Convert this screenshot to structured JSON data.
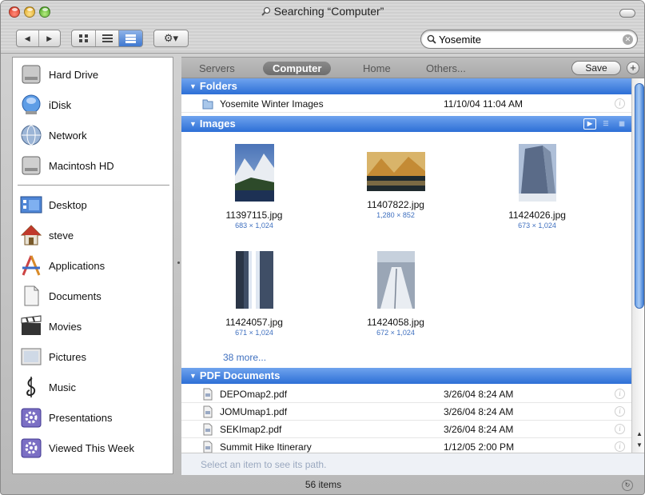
{
  "window": {
    "title": "Searching “Computer”",
    "status": "56 items"
  },
  "toolbar": {
    "back_glyph": "◀",
    "forward_glyph": "▶",
    "action_glyph": "⚙▾",
    "search_value": "Yosemite",
    "search_clear_glyph": "✕"
  },
  "sidebar": {
    "devices": [
      {
        "label": "Hard Drive",
        "icon": "hard-drive-icon"
      },
      {
        "label": "iDisk",
        "icon": "idisk-icon"
      },
      {
        "label": "Network",
        "icon": "network-icon"
      },
      {
        "label": "Macintosh HD",
        "icon": "macintosh-hd-icon"
      }
    ],
    "places": [
      {
        "label": "Desktop",
        "icon": "desktop-icon"
      },
      {
        "label": "steve",
        "icon": "home-icon"
      },
      {
        "label": "Applications",
        "icon": "applications-icon"
      },
      {
        "label": "Documents",
        "icon": "documents-icon"
      },
      {
        "label": "Movies",
        "icon": "movies-icon"
      },
      {
        "label": "Pictures",
        "icon": "pictures-icon"
      },
      {
        "label": "Music",
        "icon": "music-icon"
      },
      {
        "label": "Presentations",
        "icon": "smart-folder-icon"
      },
      {
        "label": "Viewed This Week",
        "icon": "smart-folder-icon"
      }
    ]
  },
  "scope": {
    "items": [
      "Servers",
      "Computer",
      "Home",
      "Others..."
    ],
    "active": "Computer",
    "save_label": "Save",
    "add_glyph": "+"
  },
  "sections": {
    "folders": {
      "title": "Folders",
      "rows": [
        {
          "name": "Yosemite Winter Images",
          "date": "11/10/04 11:04 AM"
        }
      ]
    },
    "images": {
      "title": "Images",
      "items": [
        {
          "name": "11397115.jpg",
          "dims": "683 × 1,024"
        },
        {
          "name": "11407822.jpg",
          "dims": "1,280 × 852"
        },
        {
          "name": "11424026.jpg",
          "dims": "673 × 1,024"
        },
        {
          "name": "11424057.jpg",
          "dims": "671 × 1,024"
        },
        {
          "name": "11424058.jpg",
          "dims": "672 × 1,024"
        }
      ],
      "more": "38 more..."
    },
    "pdfs": {
      "title": "PDF Documents",
      "rows": [
        {
          "name": "DEPOmap2.pdf",
          "date": "3/26/04 8:24 AM"
        },
        {
          "name": "JOMUmap1.pdf",
          "date": "3/26/04 8:24 AM"
        },
        {
          "name": "SEKImap2.pdf",
          "date": "3/26/04 8:24 AM"
        },
        {
          "name": "Summit Hike Itinerary",
          "date": "1/12/05 2:00 PM"
        }
      ]
    }
  },
  "pathbar": {
    "hint": "Select an item to see its path."
  },
  "glyphs": {
    "disclosure": "▼",
    "info": "i"
  },
  "colors": {
    "section_blue": "#3b7de0",
    "link_blue": "#3e6fbf"
  }
}
